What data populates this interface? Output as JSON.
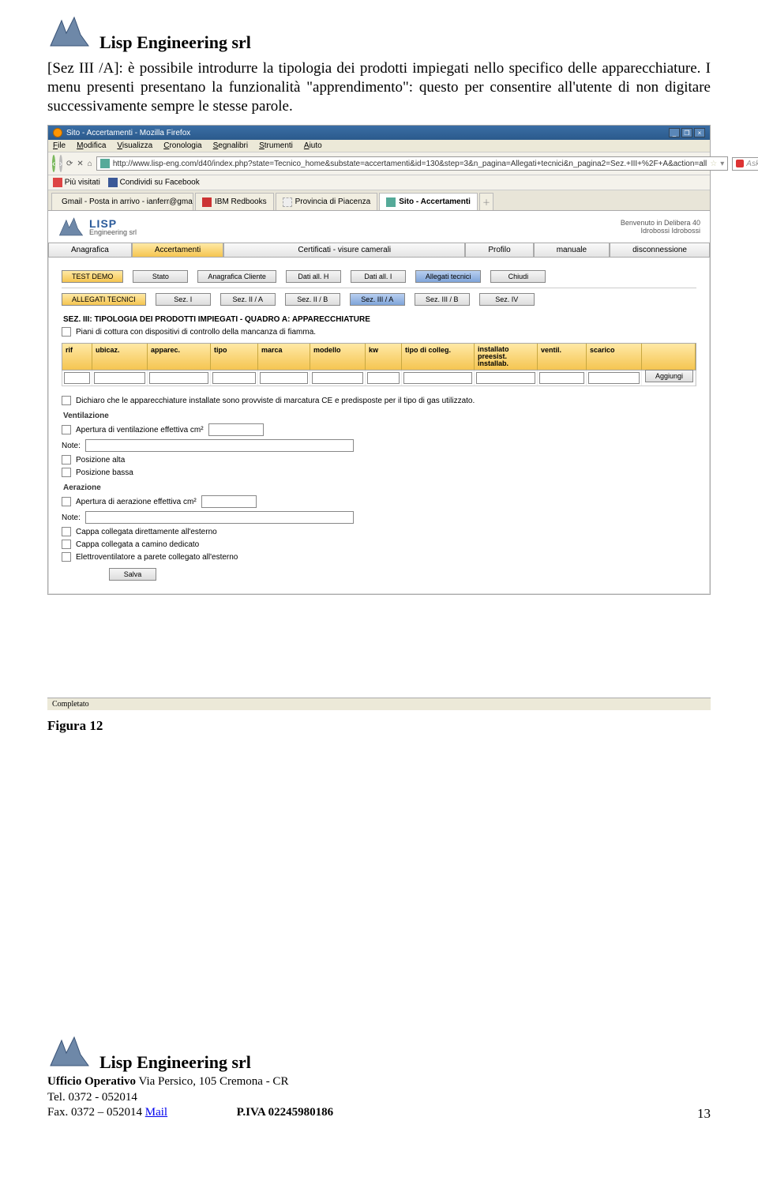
{
  "doc": {
    "company": "Lisp Engineering srl",
    "paragraph": "[Sez III /A]: è possibile introdurre la tipologia dei prodotti impiegati nello specifico delle apparecchiature. I menu presenti presentano la funzionalità \"apprendimento\": questo per consentire all'utente di non digitare successivamente sempre le stesse parole.",
    "figure_caption": "Figura 12"
  },
  "browser": {
    "title": "Sito - Accertamenti - Mozilla Firefox",
    "menus": [
      "File",
      "Modifica",
      "Visualizza",
      "Cronologia",
      "Segnalibri",
      "Strumenti",
      "Aiuto"
    ],
    "url": "http://www.lisp-eng.com/d40/index.php?state=Tecnico_home&substate=accertamenti&id=130&step=3&n_pagina=Allegati+tecnici&n_pagina2=Sez.+III+%2F+A&action=all",
    "search_placeholder": "Ask.com",
    "bookmarks": {
      "piu_visitati": "Più visitati",
      "condividi": "Condividi su Facebook"
    },
    "tabs": [
      {
        "label": "Gmail - Posta in arrivo - ianferr@gmail.c..."
      },
      {
        "label": "IBM Redbooks"
      },
      {
        "label": "Provincia di Piacenza"
      },
      {
        "label": "Sito - Accertamenti",
        "active": true
      }
    ],
    "status": "Completato"
  },
  "app": {
    "brand_line1": "LISP",
    "brand_line2": "Engineering srl",
    "welcome_line1": "Benvenuto in Delibera 40",
    "welcome_line2": "Idrobossi Idrobossi",
    "main_tabs": [
      "Anagrafica",
      "Accertamenti",
      "Certificati - visure camerali",
      "Profilo",
      "manuale",
      "disconnessione"
    ],
    "row1": [
      "TEST DEMO",
      "Stato",
      "Anagrafica Cliente",
      "Dati all. H",
      "Dati all. I",
      "Allegati tecnici",
      "Chiudi"
    ],
    "row2": [
      "ALLEGATI TECNICI",
      "Sez. I",
      "Sez. II / A",
      "Sez. II / B",
      "Sez. III / A",
      "Sez. III / B",
      "Sez. IV"
    ],
    "section_title": "SEZ. III: TIPOLOGIA DEI PRODOTTI IMPIEGATI - QUADRO A: APPARECCHIATURE",
    "chk_piani": "Piani di cottura con dispositivi di controllo della mancanza di fiamma.",
    "grid_headers": [
      "rif",
      "ubicaz.",
      "apparec.",
      "tipo",
      "marca",
      "modello",
      "kw",
      "tipo di colleg.",
      "installato preesist. installab.",
      "ventil.",
      "scarico"
    ],
    "btn_aggiungi": "Aggiungi",
    "chk_dichiaro": "Dichiaro che le apparecchiature installate sono provviste di marcatura CE e predisposte per il tipo di gas utilizzato.",
    "vent": {
      "title": "Ventilazione",
      "apertura": "Apertura di ventilazione effettiva cm²",
      "note": "Note:",
      "pos_alta": "Posizione alta",
      "pos_bassa": "Posizione bassa"
    },
    "aer": {
      "title": "Aerazione",
      "apertura": "Apertura di aerazione effettiva cm²",
      "note": "Note:",
      "cappa1": "Cappa collegata direttamente all'esterno",
      "cappa2": "Cappa collegata a camino dedicato",
      "elettro": "Elettroventilatore a parete collegato all'esterno"
    },
    "btn_salva": "Salva"
  },
  "footer": {
    "ufficio_lbl": "Ufficio Operativo",
    "ufficio_val": " Via Persico, 105 Cremona - CR",
    "tel": "Tel.  0372 - 052014",
    "fax": "Fax. 0372 – 052014  ",
    "mail": "Mail",
    "piva_lbl": "P.IVA 02245980186",
    "pagenum": "13"
  }
}
